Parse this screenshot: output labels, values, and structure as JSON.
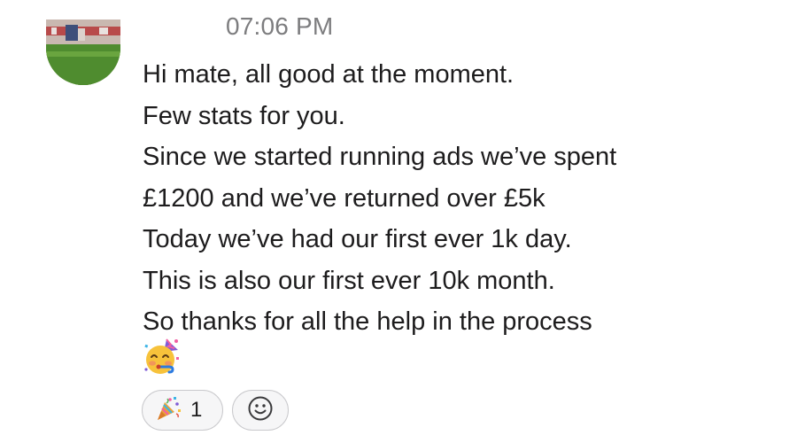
{
  "message": {
    "timestamp": "07:06 PM",
    "lines": [
      "Hi mate, all good at the moment.",
      "Few stats for you.",
      "Since we started running ads we’ve spent",
      "£1200 and we’ve returned over £5k",
      "Today we’ve had our first ever 1k day.",
      "This is also our first ever 10k month.",
      "So thanks for all the help in the process"
    ],
    "trailing_emoji": "partying-face-icon"
  },
  "reactions": [
    {
      "emoji": "party-popper-icon",
      "count": "1"
    }
  ],
  "add_reaction_icon": "smiley-face-icon"
}
